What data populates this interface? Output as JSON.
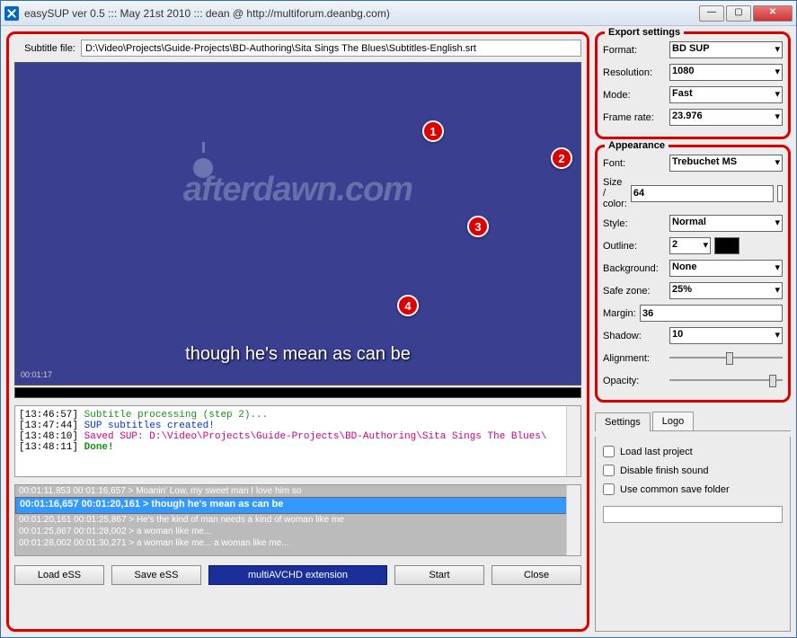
{
  "window": {
    "title": "easySUP ver 0.5 ::: May 21st 2010 ::: dean @ http://multiforum.deanbg.com)"
  },
  "subtitle_file": {
    "label": "Subtitle file:",
    "value": "D:\\Video\\Projects\\Guide-Projects\\BD-Authoring\\Sita Sings The Blues\\Subtitles-English.srt"
  },
  "preview": {
    "watermark": "afterdawn.com",
    "subtitle_text": "though he's mean as can be",
    "timecode": "00:01:17"
  },
  "log_lines": [
    {
      "ts": "[13:46:57]",
      "text": "Subtitle processing (step 2)...",
      "cls": "l1"
    },
    {
      "ts": "[13:47:44]",
      "text": "SUP subtitles created!",
      "cls": "l2"
    },
    {
      "ts": "[13:48:10]",
      "text": "Saved SUP: D:\\Video\\Projects\\Guide-Projects\\BD-Authoring\\Sita Sings The Blues\\",
      "cls": "l3"
    },
    {
      "ts": "[13:48:11]",
      "text": "Done!",
      "cls": "l4"
    }
  ],
  "subtitle_list": [
    "00:01:11,853 00:01:16,657 > Moanin' Low, my sweet man I love him so",
    "00:01:16,657 00:01:20,161 > though he's mean as can be",
    "00:01:20,161 00:01:25,867 > He's the kind of man needs a kind of woman like me",
    "00:01:25,867 00:01:28,002 > a woman like me...",
    "00:01:28,002 00:01:30,271 > a woman like me... a woman like me..."
  ],
  "subtitle_list_selected_index": 1,
  "buttons": {
    "load": "Load eSS",
    "save": "Save eSS",
    "ext": "multiAVCHD extension",
    "start": "Start",
    "close": "Close"
  },
  "export": {
    "legend": "Export settings",
    "format_label": "Format:",
    "format": "BD SUP",
    "resolution_label": "Resolution:",
    "resolution": "1080",
    "mode_label": "Mode:",
    "mode": "Fast",
    "framerate_label": "Frame rate:",
    "framerate": "23.976"
  },
  "appearance": {
    "legend": "Appearance",
    "font_label": "Font:",
    "font": "Trebuchet MS",
    "size_label": "Size / color:",
    "size": "64",
    "style_label": "Style:",
    "style": "Normal",
    "outline_label": "Outline:",
    "outline": "2",
    "background_label": "Background:",
    "background": "None",
    "safezone_label": "Safe zone:",
    "safezone": "25%",
    "margin_label": "Margin:",
    "margin": "36",
    "shadow_label": "Shadow:",
    "shadow": "10",
    "alignment_label": "Alignment:",
    "opacity_label": "Opacity:"
  },
  "tabs": {
    "settings": "Settings",
    "logo": "Logo"
  },
  "settings": {
    "load_last": "Load last project",
    "disable_sound": "Disable finish sound",
    "use_common_folder": "Use common save folder"
  },
  "markers": {
    "m1": "1",
    "m2": "2",
    "m3": "3",
    "m4": "4"
  }
}
